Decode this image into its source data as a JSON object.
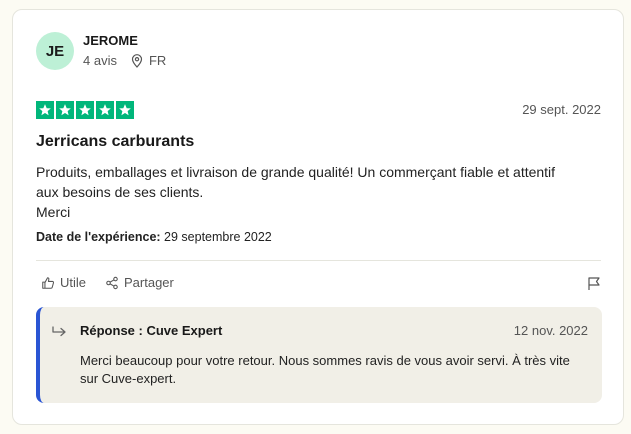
{
  "user": {
    "initials": "JE",
    "name": "JEROME",
    "reviews": "4 avis",
    "country": "FR"
  },
  "review": {
    "rating": 5,
    "date": "29 sept. 2022",
    "title": "Jerricans carburants",
    "body_lines": [
      "Produits, emballages et livraison de grande qualité! Un commerçant fiable et attentif",
      "aux besoins de ses clients.",
      "Merci"
    ],
    "experience_label": "Date de l'expérience:",
    "experience_date": "29 septembre 2022"
  },
  "actions": {
    "useful": "Utile",
    "share": "Partager"
  },
  "reply": {
    "title": "Réponse : Cuve Expert",
    "date": "12 nov. 2022",
    "text": "Merci beaucoup pour votre retour. Nous sommes ravis de vous avoir servi. À très vite sur Cuve-expert."
  },
  "colors": {
    "star_green": "#00b67a",
    "avatar_bg": "#bdf0d6",
    "reply_accent": "#2a55d4"
  }
}
